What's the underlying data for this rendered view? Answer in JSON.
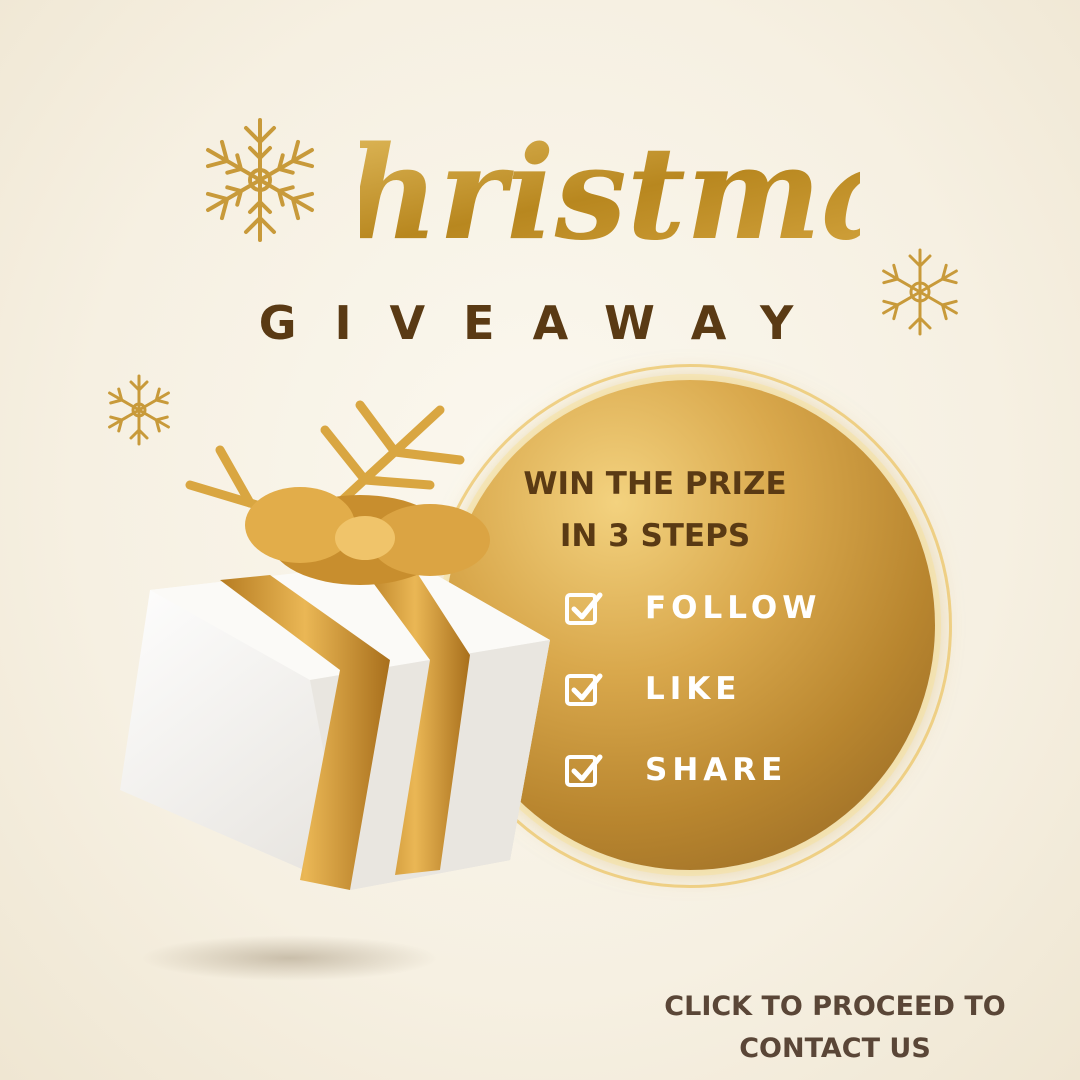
{
  "title": "Christmas",
  "subtitle": "GIVEAWAY",
  "panel": {
    "heading_line1": "WIN THE PRIZE",
    "heading_line2": "IN 3 STEPS",
    "steps": [
      {
        "label": "FOLLOW",
        "icon": "checkbox-checked-icon"
      },
      {
        "label": "LIKE",
        "icon": "checkbox-checked-icon"
      },
      {
        "label": "SHARE",
        "icon": "checkbox-checked-icon"
      }
    ]
  },
  "cta": {
    "line1": "CLICK TO PROCEED TO",
    "line2": "CONTACT US"
  },
  "colors": {
    "brown": "#5a3a14",
    "gold": "#c9972f",
    "background": "#f6f0e2",
    "cta_text": "#5a4637"
  },
  "icons": [
    "snowflake-icon",
    "gift-box-icon",
    "checkbox-checked-icon"
  ]
}
